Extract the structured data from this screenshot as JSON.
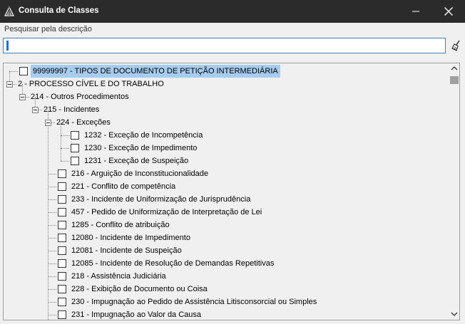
{
  "window": {
    "title": "Consulta de Classes"
  },
  "search": {
    "label": "Pesquisar pela descrição",
    "value": ""
  },
  "icons": {
    "app": "app-logo-icon",
    "minimize": "minimize-icon",
    "close": "close-icon",
    "clear": "broom-icon",
    "scroll_up": "chevron-up-icon",
    "scroll_down": "chevron-down-icon"
  },
  "colors": {
    "titlebar": "#2b2b2b",
    "selection": "#a6ccf0",
    "input_border": "#3c7fb1"
  },
  "tree": {
    "nodes": [
      {
        "label": "99999997 - TIPOS DE DOCUMENTO DE PETIÇÃO INTERMEDIÁRIA",
        "level": 0,
        "checkbox": true,
        "selected": true
      },
      {
        "label": "2 - PROCESSO CÍVEL E DO TRABALHO",
        "level": 0,
        "expander": true
      },
      {
        "label": "214 - Outros Procedimentos",
        "level": 1,
        "expander": true
      },
      {
        "label": "215 - Incidentes",
        "level": 2,
        "expander": true
      },
      {
        "label": "224 - Exceções",
        "level": 3,
        "expander": true
      },
      {
        "label": "1232 - Exceção de Incompetência",
        "level": 4,
        "checkbox": true
      },
      {
        "label": "1230 - Exceção de Impedimento",
        "level": 4,
        "checkbox": true
      },
      {
        "label": "1231 - Exceção de Suspeição",
        "level": 4,
        "checkbox": true
      },
      {
        "label": "216 - Arguição de Inconstitucionalidade",
        "level": 3,
        "checkbox": true
      },
      {
        "label": "221 - Conflito de competência",
        "level": 3,
        "checkbox": true
      },
      {
        "label": "233 - Incidente de Uniformização de Jurisprudência",
        "level": 3,
        "checkbox": true
      },
      {
        "label": "457 - Pedido de Uniformização de Interpretação de Lei",
        "level": 3,
        "checkbox": true
      },
      {
        "label": "1285 - Conflito de atribuição",
        "level": 3,
        "checkbox": true
      },
      {
        "label": "12080 - Incidente de Impedimento",
        "level": 3,
        "checkbox": true
      },
      {
        "label": "12081 - Incidente de Suspeição",
        "level": 3,
        "checkbox": true
      },
      {
        "label": "12085 - Incidente de Resolução de Demandas Repetitivas",
        "level": 3,
        "checkbox": true
      },
      {
        "label": "218 - Assistência Judiciária",
        "level": 3,
        "checkbox": true
      },
      {
        "label": "228 - Exibição de Documento ou Coisa",
        "level": 3,
        "checkbox": true
      },
      {
        "label": "230 - Impugnação ao Pedido de Assistência Litisconsorcial ou Simples",
        "level": 3,
        "checkbox": true
      },
      {
        "label": "231 - Impugnação ao Valor da Causa",
        "level": 3,
        "checkbox": true
      }
    ]
  }
}
